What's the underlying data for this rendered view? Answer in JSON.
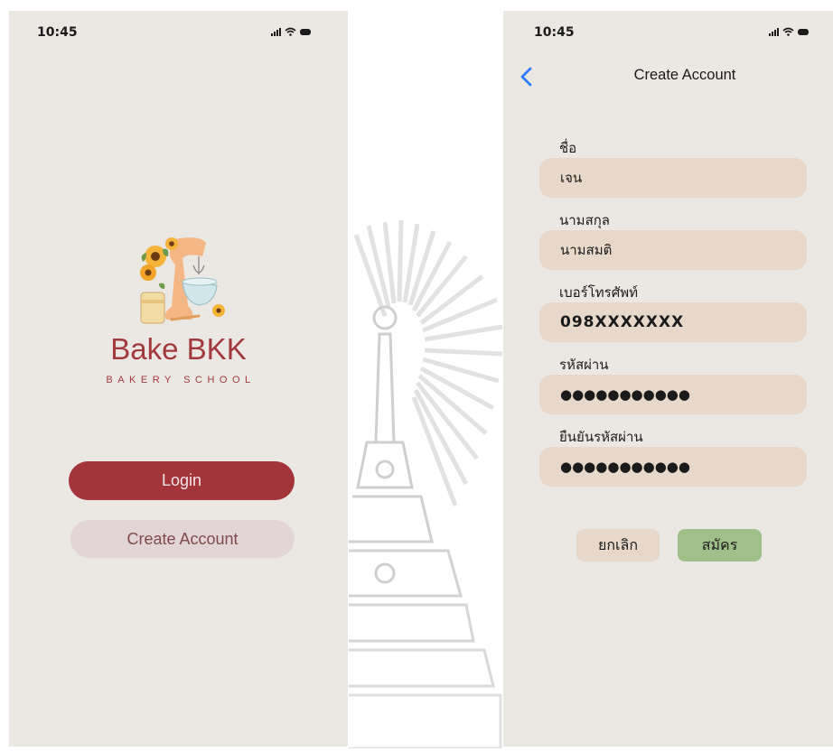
{
  "left_screen": {
    "status_time": "10:45",
    "brand_title": "Bake BKK",
    "brand_subtitle": "BAKERY SCHOOL",
    "login_label": "Login",
    "create_account_label": "Create Account",
    "logo_icon": "bakery-logo-icon"
  },
  "right_screen": {
    "status_time": "10:45",
    "title": "Create Account",
    "back_icon": "chevron-left-icon",
    "fields": [
      {
        "label": "ชื่อ",
        "value": "เจน"
      },
      {
        "label": "นามสกุล",
        "value": "นามสมติ"
      },
      {
        "label": "เบอร์โทรศัพท์",
        "value": "098XXXXXXX"
      },
      {
        "label": "รหัสผ่าน",
        "value": "●●●●●●●●●●●"
      },
      {
        "label": "ยืนยันรหัสผ่าน",
        "value": "●●●●●●●●●●●"
      }
    ],
    "cancel_label": "ยกเลิก",
    "register_label": "สมัคร"
  },
  "colors": {
    "background": "#ebe8e3",
    "brand": "#a2393d",
    "login_button": "#a3343a",
    "create_button": "#e3d5d6",
    "field_bg": "#e8d8ca",
    "register_button": "#9fc08a",
    "back_arrow": "#2f7cf6"
  }
}
